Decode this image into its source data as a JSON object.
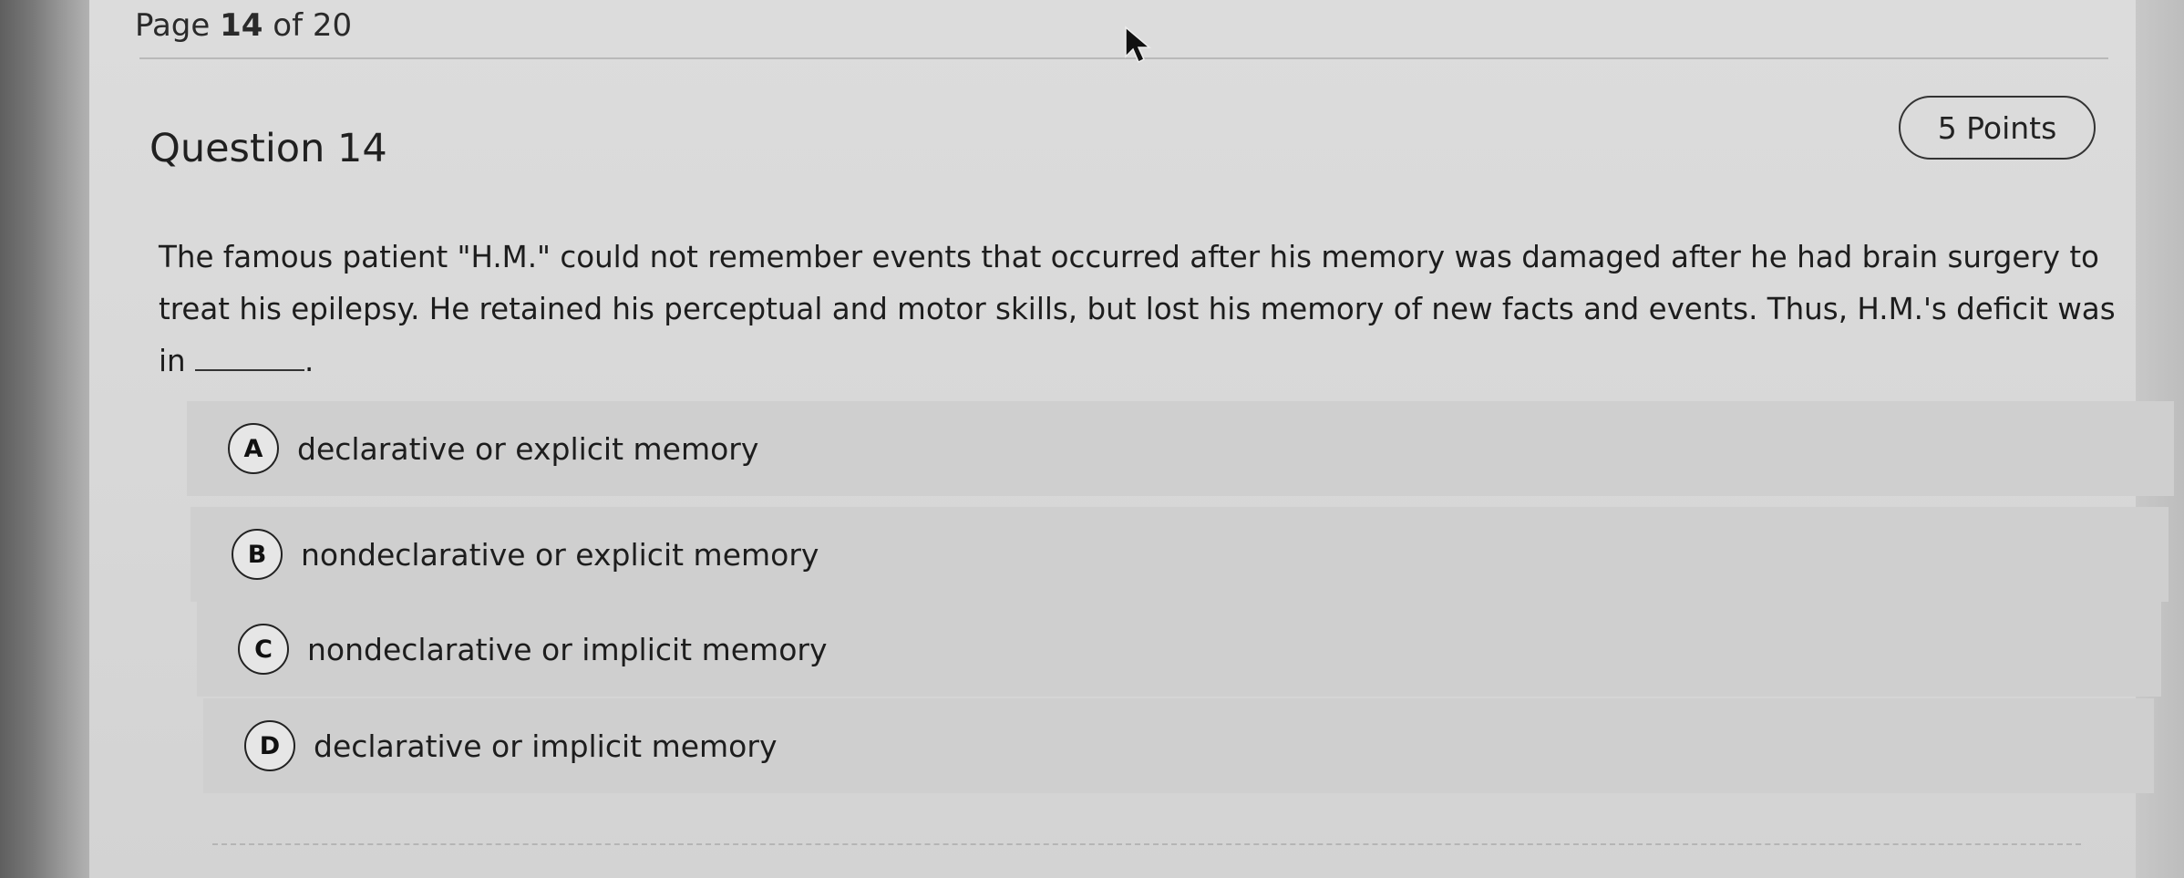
{
  "page": {
    "label_prefix": "Page",
    "current": "14",
    "of_text": "of 20"
  },
  "question": {
    "title": "Question 14",
    "points": "5 Points",
    "text_line1": "The famous patient \"H.M.\" could not remember events that occurred after his memory was damaged after he had brain surgery to",
    "text_line2": "treat his epilepsy. He retained his perceptual and motor skills, but lost his memory of new facts and events. Thus, H.M.'s deficit was",
    "text_line3_start": "in",
    "text_line3_end": "."
  },
  "options": [
    {
      "letter": "A",
      "label": "declarative or explicit memory"
    },
    {
      "letter": "B",
      "label": "nondeclarative or explicit memory"
    },
    {
      "letter": "C",
      "label": "nondeclarative or implicit memory"
    },
    {
      "letter": "D",
      "label": "declarative or implicit memory"
    }
  ],
  "icons": {
    "cursor": "mouse-pointer-icon"
  }
}
